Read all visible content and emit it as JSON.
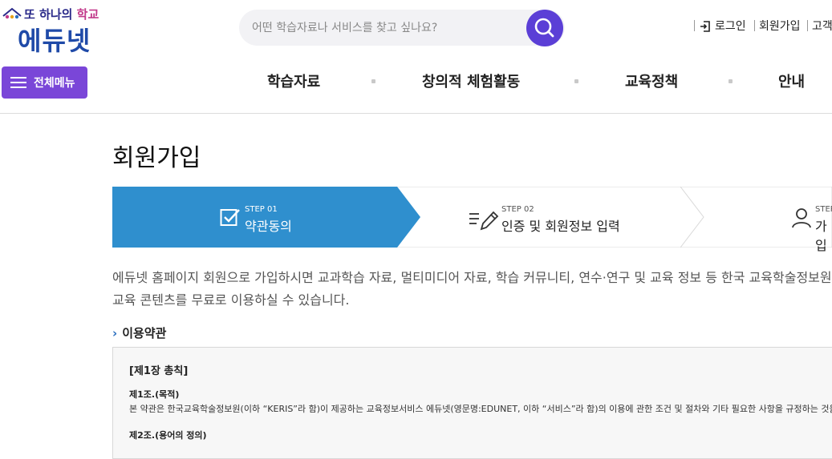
{
  "header": {
    "logo_tagline_prefix": "또 하나의 ",
    "logo_tagline_highlight": "학교",
    "logo_name": "에듀넷",
    "search": {
      "placeholder": "어떤 학습자료나 서비스를 찾고 싶나요?"
    },
    "util_links": {
      "login": "로그인",
      "join": "회원가입",
      "customer": "고객"
    },
    "menu_button": "전체메뉴",
    "nav": [
      "학습자료",
      "창의적 체험활동",
      "교육정책",
      "안내"
    ]
  },
  "main": {
    "title": "회원가입",
    "steps": [
      {
        "step": "STEP 01",
        "label": "약관동의",
        "active": true,
        "icon": "checkbox-icon"
      },
      {
        "step": "STEP 02",
        "label": "인증 및 회원정보 입력",
        "active": false,
        "icon": "edit-icon"
      },
      {
        "step": "STEP",
        "label": "가입",
        "active": false,
        "icon": "user-icon"
      }
    ],
    "intro_line1": "에듀넷 홈페이지 회원으로 가입하시면 교과학습 자료, 멀티미디어 자료, 학습 커뮤니티, 연수·연구 및 교육 정보 등 한국 교육학술정보원이",
    "intro_line2": "교육 콘텐츠를 무료로 이용하실 수 있습니다.",
    "terms_heading": "이용약관",
    "terms": {
      "chapter": "[제1장 총칙]",
      "article1_title": "제1조.(목적)",
      "article1_body": "본 약관은 한국교육학술정보원(이하 “KERIS”라 함)이 제공하는 교육정보서비스 에듀넷(영문명:EDUNET, 이하 “서비스”라 함)의 이용에 관한 조건 및 절차와 기타 필요한 사항을 규정하는 것을 목적으",
      "article2_title": "제2조.(용어의 정의)"
    }
  },
  "colors": {
    "brand_blue": "#1f4aa8",
    "purple": "#7a46d8",
    "search_purple": "#5b3fd6",
    "step_active": "#2f8fce"
  }
}
